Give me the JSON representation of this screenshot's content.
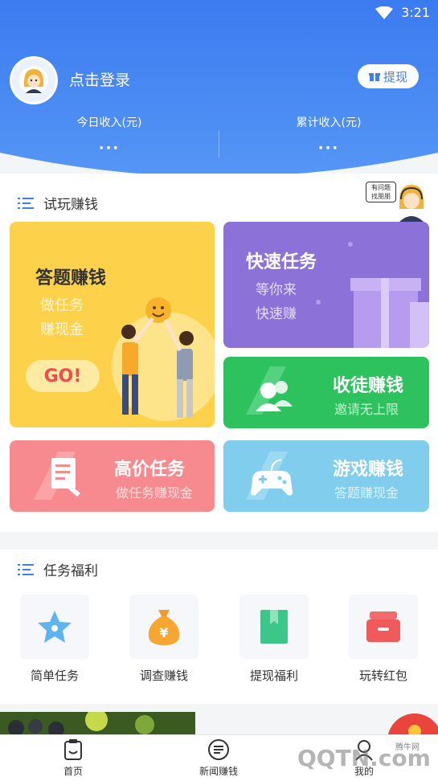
{
  "status_bar": {
    "time": "3:21"
  },
  "header": {
    "login_text": "点击登录",
    "withdraw_label": "提现",
    "today_income_label": "今日收入(元)",
    "today_income_value": "···",
    "total_income_label": "累计收入(元)",
    "total_income_value": "···"
  },
  "trial": {
    "title": "试玩赚钱",
    "helper_bubble": "有问题\n找朋朋",
    "tiles": {
      "answer": {
        "title": "答题赚钱",
        "line1": "做任务",
        "line2": "赚现金",
        "go": "GO!"
      },
      "quick": {
        "title": "快速任务",
        "line1": "等你来",
        "line2": "快速赚"
      },
      "recruit": {
        "title": "收徒赚钱",
        "sub": "邀请无上限"
      },
      "highprice": {
        "title": "高价任务",
        "sub": "做任务赚现金"
      },
      "game": {
        "title": "游戏赚钱",
        "sub": "答题赚现金"
      }
    }
  },
  "welfare": {
    "title": "任务福利",
    "items": [
      {
        "label": "简单任务",
        "icon": "star-icon"
      },
      {
        "label": "调查赚钱",
        "icon": "money-bag-icon"
      },
      {
        "label": "提现福利",
        "icon": "book-icon"
      },
      {
        "label": "玩转红包",
        "icon": "red-box-icon"
      }
    ]
  },
  "bottom_nav": {
    "home": "首页",
    "news": "新闻赚钱",
    "mine": "我的"
  },
  "watermark": "QQTN.com",
  "watermark_small": "腾牛网",
  "colors": {
    "header_blue": "#3d7ff0",
    "yellow": "#fcd34b",
    "purple": "#8c73d9",
    "green": "#2fc35f",
    "pink": "#f78a8e",
    "sky": "#81cdef"
  }
}
